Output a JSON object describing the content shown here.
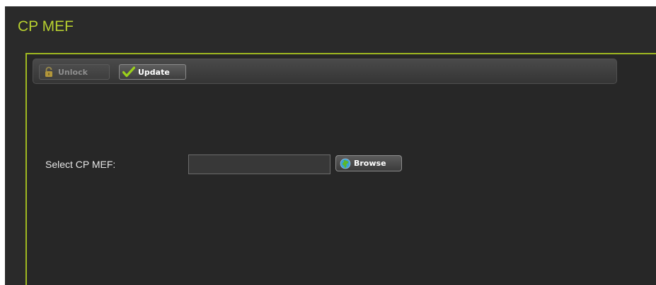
{
  "page": {
    "title": "CP MEF"
  },
  "toolbar": {
    "unlock_label": "Unlock",
    "unlock_icon": "padlock-icon",
    "update_label": "Update",
    "update_icon": "checkmark-icon"
  },
  "form": {
    "select_label": "Select CP MEF:",
    "file_value": "",
    "browse_label": "Browse",
    "browse_icon": "globe-icon"
  },
  "colors": {
    "accent": "#b7cf2f",
    "panel_border": "#9fb821",
    "background": "#2a2a2a",
    "checkmark": "#9bd11b",
    "padlock": "#c9a43a"
  }
}
